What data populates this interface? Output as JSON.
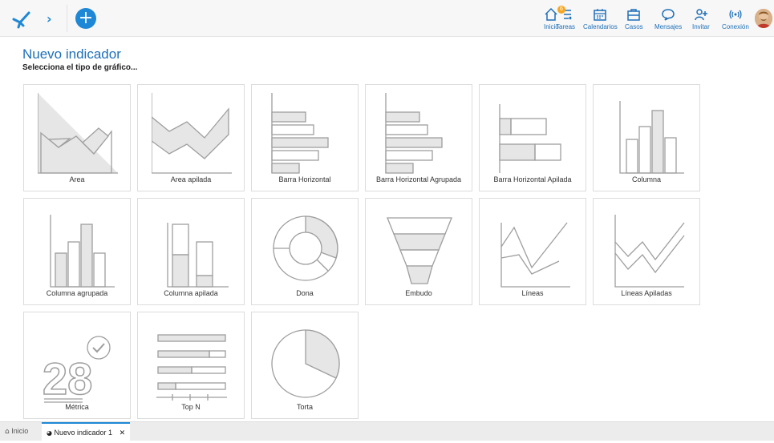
{
  "header": {
    "nav": [
      {
        "label": "Inicio",
        "icon": "home-icon"
      },
      {
        "label": "Tareas",
        "icon": "tasks-icon",
        "badge": "6"
      },
      {
        "label": "Calendarios",
        "icon": "calendar-icon"
      },
      {
        "label": "Casos",
        "icon": "briefcase-icon"
      },
      {
        "label": "Mensajes",
        "icon": "chat-icon"
      },
      {
        "label": "Invitar",
        "icon": "invite-user-icon"
      },
      {
        "label": "Conexión",
        "icon": "connection-icon"
      }
    ]
  },
  "page": {
    "title": "Nuevo indicador",
    "subtitle": "Selecciona el tipo de gráfico..."
  },
  "chart_types": [
    {
      "label": "Area",
      "icon": "area-chart-icon"
    },
    {
      "label": "Area apilada",
      "icon": "stacked-area-chart-icon"
    },
    {
      "label": "Barra Horizontal",
      "icon": "horizontal-bar-chart-icon"
    },
    {
      "label": "Barra Horizontal Agrupada",
      "icon": "grouped-horizontal-bar-chart-icon"
    },
    {
      "label": "Barra Horizontal Apilada",
      "icon": "stacked-horizontal-bar-chart-icon"
    },
    {
      "label": "Columna",
      "icon": "column-chart-icon"
    },
    {
      "label": "Columna agrupada",
      "icon": "grouped-column-chart-icon"
    },
    {
      "label": "Columna apilada",
      "icon": "stacked-column-chart-icon"
    },
    {
      "label": "Dona",
      "icon": "donut-chart-icon"
    },
    {
      "label": "Embudo",
      "icon": "funnel-chart-icon"
    },
    {
      "label": "Líneas",
      "icon": "line-chart-icon"
    },
    {
      "label": "Líneas Apiladas",
      "icon": "stacked-line-chart-icon"
    },
    {
      "label": "Métrica",
      "icon": "metric-icon",
      "icon_text": "28"
    },
    {
      "label": "Top N",
      "icon": "top-n-icon"
    },
    {
      "label": "Torta",
      "icon": "pie-chart-icon"
    }
  ],
  "tabs": [
    {
      "label": "Inicio",
      "icon": "home-icon"
    },
    {
      "label": "Nuevo indicador 1",
      "icon": "gauge-icon",
      "active": true
    }
  ],
  "colors": {
    "accent": "#1e88d6",
    "title": "#1e6fb8",
    "icon_stroke": "#9e9e9e",
    "icon_fill": "#e6e6e6",
    "badge": "#f5a623"
  }
}
